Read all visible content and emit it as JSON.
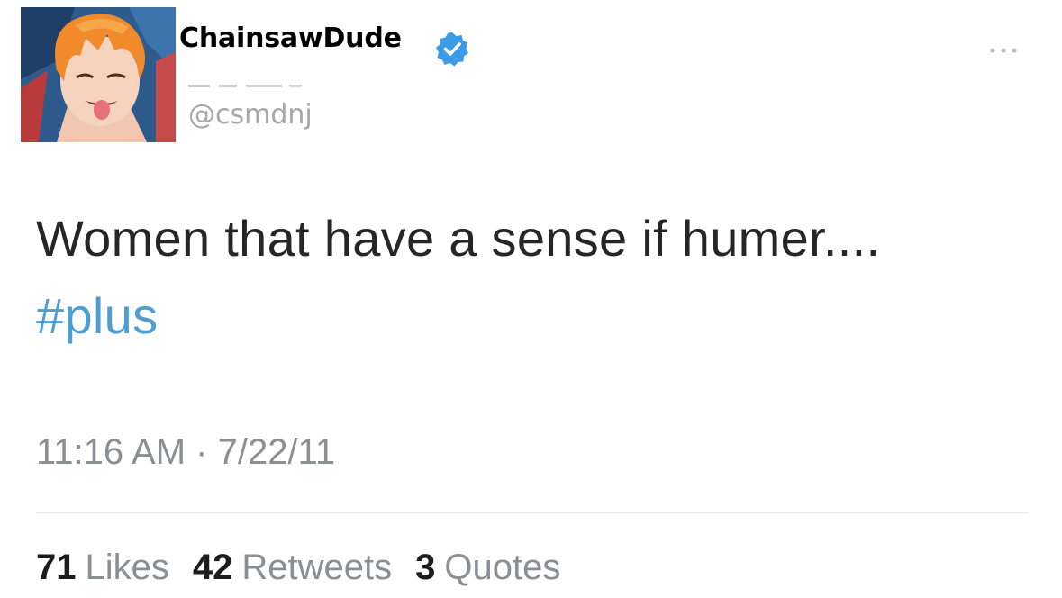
{
  "tweet": {
    "author": {
      "display_name": "ChainsawDude",
      "handle": "@csmdnj",
      "verified": true,
      "avatar_icon": "anime-avatar-icon"
    },
    "text": "Women that have a sense if humer....",
    "hashtag": "#plus",
    "timestamp": "11:16 AM · 7/22/11",
    "stats": [
      {
        "count": "71",
        "label": "Likes"
      },
      {
        "count": "42",
        "label": "Retweets"
      },
      {
        "count": "3",
        "label": "Quotes"
      }
    ]
  },
  "colors": {
    "hashtag": "#4f9ed1",
    "verified": "#3b9be6",
    "muted_text": "#8a8f94"
  }
}
